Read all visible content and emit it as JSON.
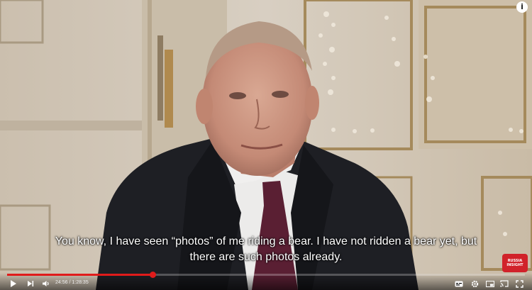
{
  "caption": {
    "line1": "You know, I have seen “photos” of me riding a bear. I have not ridden a bear yet, but",
    "line2": "there are such photos already."
  },
  "info_button_label": "i",
  "watermark": {
    "line1": "RUSSIA",
    "line2": "INSIGHT"
  },
  "player": {
    "time_display": "24:56 / 1:28:35",
    "progress_fraction": 0.281,
    "accent_color": "#e01b1b"
  },
  "icons": [
    "play-icon",
    "next-icon",
    "volume-icon",
    "subtitles-icon",
    "settings-icon",
    "miniplayer-icon",
    "cast-icon",
    "fullscreen-icon",
    "info-icon"
  ]
}
